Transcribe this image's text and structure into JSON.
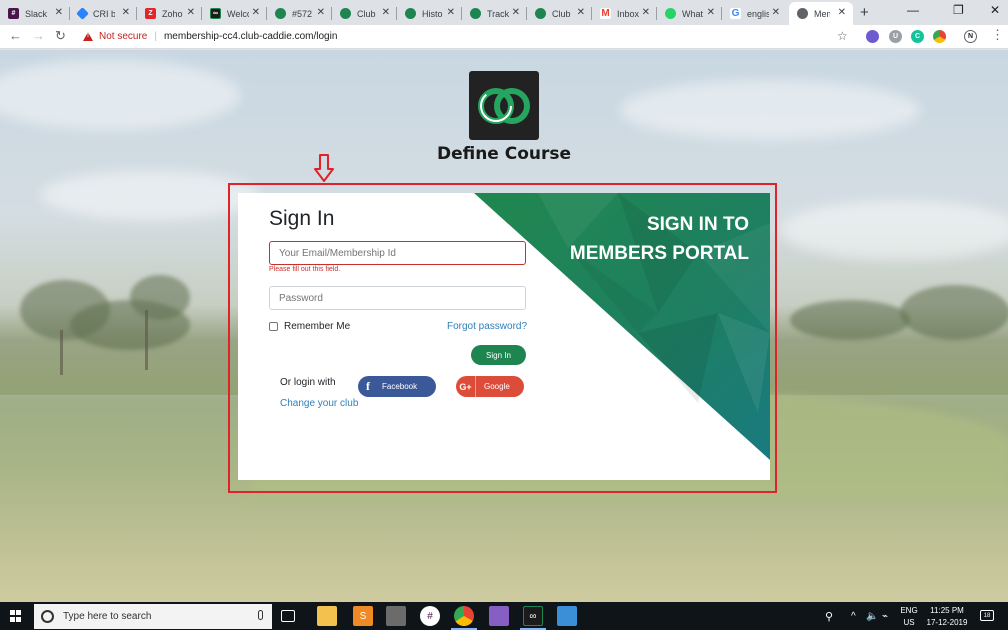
{
  "browser": {
    "tabs": [
      {
        "title": "Slack",
        "fav_color": "#4a154b",
        "fav_icon": "slack-icon"
      },
      {
        "title": "CRI b",
        "fav_color": "#2684ff",
        "fav_icon": "jira-icon"
      },
      {
        "title": "Zoho",
        "fav_color": "#e42527",
        "fav_icon": "zoho-icon"
      },
      {
        "title": "Welco",
        "fav_color": "#1b1b1b",
        "fav_icon": "club-caddie-icon"
      },
      {
        "title": "#572",
        "fav_color": "#1f8550",
        "fav_icon": "club-caddie-icon"
      },
      {
        "title": "Club",
        "fav_color": "#1f8550",
        "fav_icon": "club-caddie-icon"
      },
      {
        "title": "Histo",
        "fav_color": "#1f8550",
        "fav_icon": "club-caddie-icon"
      },
      {
        "title": "Track",
        "fav_color": "#1f8550",
        "fav_icon": "club-caddie-icon"
      },
      {
        "title": "Club",
        "fav_color": "#1f8550",
        "fav_icon": "club-caddie-icon"
      },
      {
        "title": "Inbox",
        "fav_color": "#ea4335",
        "fav_icon": "gmail-icon"
      },
      {
        "title": "What",
        "fav_color": "#25d366",
        "fav_icon": "whatsapp-icon"
      },
      {
        "title": "englis",
        "fav_color": "#4285f4",
        "fav_icon": "google-icon"
      },
      {
        "title": "Mem",
        "fav_color": "#5f6368",
        "fav_icon": "globe-icon"
      }
    ],
    "new_tab": "+",
    "security_label": "Not secure",
    "url": "membership-cc4.club-caddie.com/login",
    "profile_initial": "N",
    "extensions": [
      "U",
      "C"
    ]
  },
  "page": {
    "course_name": "Define Course",
    "signin_heading": "Sign In",
    "portal_title_line1": "SIGN IN TO",
    "portal_title_line2": "MEMBERS PORTAL",
    "email_placeholder": "Your Email/Membership Id",
    "email_error": "Please fill out this field.",
    "password_placeholder": "Password",
    "remember_label": "Remember Me",
    "forgot_label": "Forgot password?",
    "signin_button": "Sign In",
    "or_login_label": "Or login with",
    "facebook_label": "Facebook",
    "google_label": "Google",
    "change_club_label": "Change your club",
    "brand_green": "#1f8550",
    "annotation_color": "#e0222a"
  },
  "taskbar": {
    "search_placeholder": "Type here to search",
    "lang_top": "ENG",
    "lang_bottom": "US",
    "time": "11:25 PM",
    "date": "17-12-2019",
    "notification_count": "18"
  }
}
